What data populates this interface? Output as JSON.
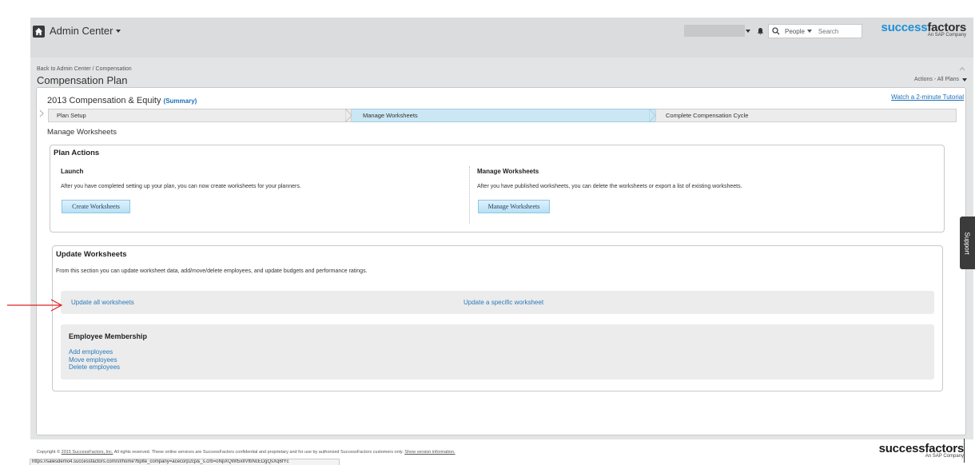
{
  "header": {
    "app_title": "Admin Center",
    "search_scope": "People",
    "search_placeholder": "Search",
    "brand_word_1": "success",
    "brand_word_2": "factors",
    "brand_sub": "An SAP Company"
  },
  "page": {
    "breadcrumb": "Back to Admin Center / Compensation",
    "title": "Compensation Plan",
    "actions_label": "Actions - All Plans"
  },
  "plan": {
    "name": "2013 Compensation & Equity",
    "summary_label": "(Summary)",
    "tutorial_link": "Watch a 2-minute Tutorial",
    "steps": [
      "Plan Setup",
      "Manage Worksheets",
      "Complete Compensation Cycle"
    ],
    "active_step": 1,
    "section_label": "Manage Worksheets"
  },
  "plan_actions": {
    "title": "Plan Actions",
    "launch_title": "Launch",
    "launch_text": "After you have completed setting up your plan, you can now create worksheets for your planners.",
    "create_button": "Create Worksheets",
    "manage_title": "Manage Worksheets",
    "manage_text": "After you have published worksheets, you can delete the worksheets or export a list of existing worksheets.",
    "manage_button": "Manage Worksheets"
  },
  "update_worksheets": {
    "title": "Update Worksheets",
    "description": "From this section you can update worksheet data, add/move/delete employees, and update budgets and performance ratings.",
    "update_all": "Update all worksheets",
    "update_specific": "Update a specific worksheet",
    "membership_title": "Employee Membership",
    "add_employees": "Add employees",
    "move_employees": "Move employees",
    "delete_employees": "Delete employees"
  },
  "support_tab": "Support",
  "footer": {
    "copyright_prefix": "Copyright ©",
    "copyright_link": "2015 SuccessFactors, Inc.",
    "copyright_text": "All rights reserved. These online services are SuccessFactors confidential and proprietary and for use by authorized SuccessFactors customers only.",
    "show_version": "Show version information.",
    "brand": "successfactors",
    "brand_sub": "An SAP Company"
  },
  "status_bar_url": "https://salesdemo4.successfactors.com/sf/home?bplte_company=acecorp2cp&_s.crb=oNpXQWt5xlIVfbNcEDgQsXq6fYc",
  "colors": {
    "brand_blue": "#1d8fd8",
    "link_blue": "#2a7ab8",
    "active_step": "#cbe7f3",
    "annotation_red": "#e02020"
  }
}
